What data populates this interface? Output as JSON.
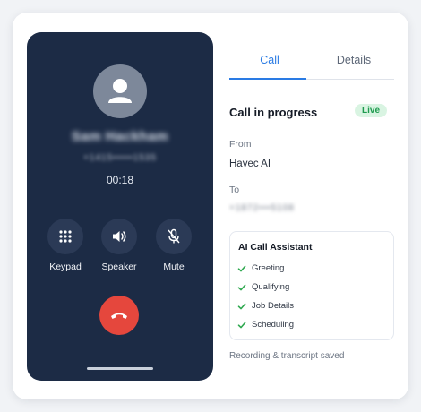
{
  "phone": {
    "caller_name": "Sam Hackham",
    "caller_number": "+1415•••••1535",
    "timer": "00:18",
    "controls": [
      {
        "label": "Keypad",
        "icon": "keypad-icon"
      },
      {
        "label": "Speaker",
        "icon": "speaker-icon"
      },
      {
        "label": "Mute",
        "icon": "microphone-muted-icon"
      }
    ],
    "end_call_icon": "phone-hangup-icon"
  },
  "tabs": {
    "call": "Call",
    "details": "Details",
    "active": "Call"
  },
  "call": {
    "status": "Call in progress",
    "badge": "Live",
    "from_label": "From",
    "from_value": "Havec AI",
    "to_label": "To",
    "to_value": "+1872•••5108"
  },
  "assistant": {
    "title": "AI Call Assistant",
    "steps": [
      "Greeting",
      "Qualifying",
      "Job Details",
      "Scheduling"
    ]
  },
  "footer_note": "Recording & transcript saved",
  "colors": {
    "accent": "#2a7be4",
    "phone_background": "#1c2b45",
    "end_call": "#e5473d",
    "live_green": "#1f9b4f",
    "check_green": "#2ea84f"
  }
}
